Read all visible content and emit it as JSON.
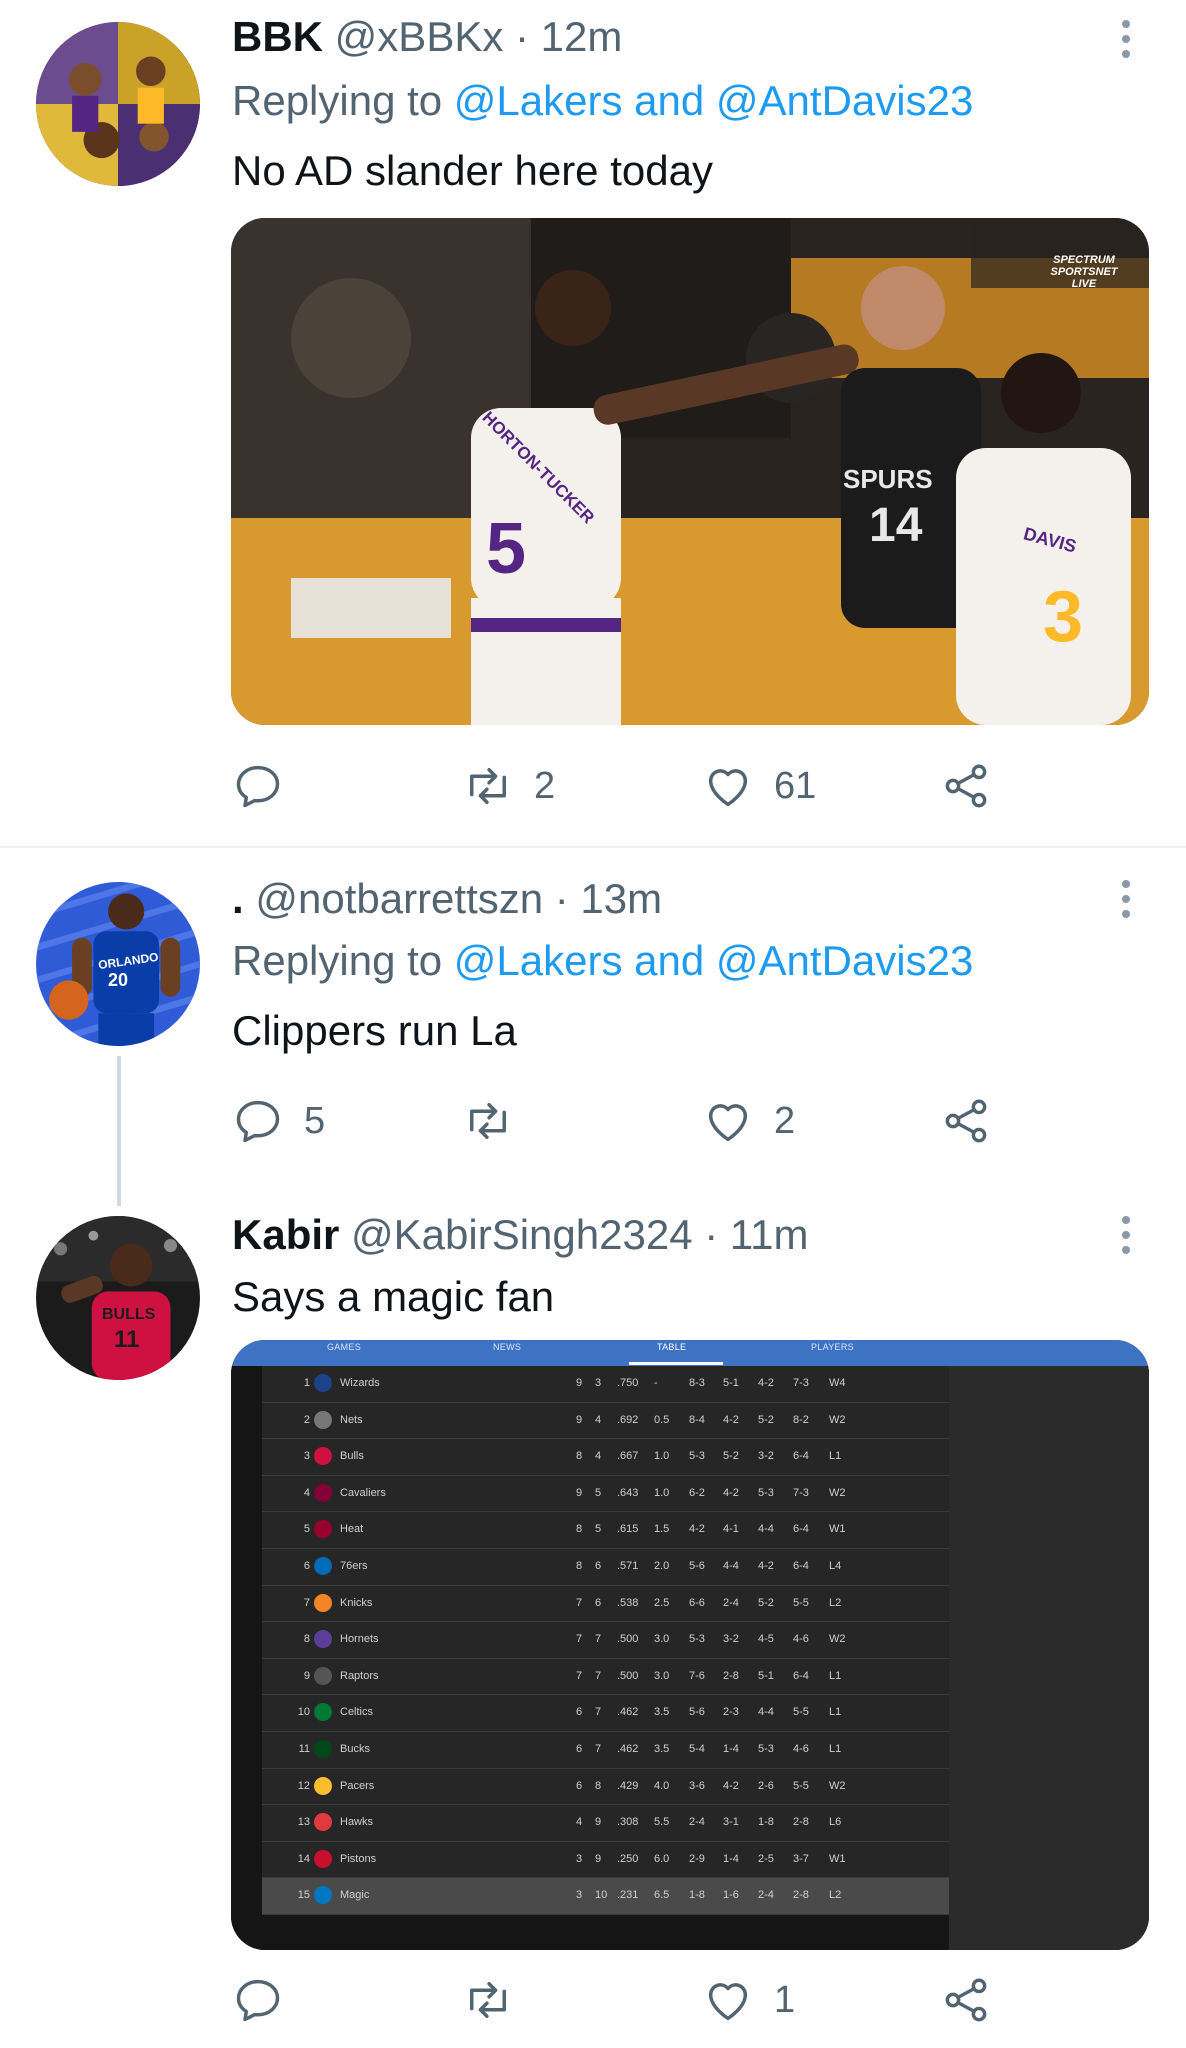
{
  "tweets": [
    {
      "name": "BBK",
      "handle": "@xBBKx",
      "time": "· 12m",
      "reply_prefix": "Replying to ",
      "reply_targets": "@Lakers and @AntDavis23",
      "text": "No AD slander here today",
      "media": {
        "type": "photo",
        "watermark": "SPECTRUM SPORTSNET LIVE",
        "jersey_numbers": [
          "5",
          "14",
          "3"
        ],
        "jersey_names": [
          "HORTON-TUCKER",
          "SPURS",
          "DAVIS"
        ]
      },
      "actions": {
        "replies": "",
        "retweets": "2",
        "likes": "61"
      }
    },
    {
      "name": ".",
      "handle": "@notbarrettszn",
      "time": "· 13m",
      "reply_prefix": "Replying to ",
      "reply_targets": "@Lakers and @AntDavis23",
      "text": "Clippers run La",
      "avatar_jersey": {
        "team": "ORLANDO",
        "number": "20"
      },
      "actions": {
        "replies": "5",
        "retweets": "",
        "likes": "2"
      }
    },
    {
      "name": "Kabir",
      "handle": "@KabirSingh2324",
      "time": "· 11m",
      "text": "Says a magic fan",
      "avatar_jersey": {
        "team": "BULLS",
        "number": "11"
      },
      "actions": {
        "replies": "",
        "retweets": "",
        "likes": "1"
      }
    }
  ],
  "standings": {
    "tabs": [
      "GAMES",
      "NEWS",
      "TABLE",
      "PLAYERS"
    ],
    "active_tab": "TABLE",
    "rows": [
      {
        "rank": "1",
        "team": "Wizards",
        "w": "9",
        "l": "3",
        "pct": ".750",
        "gb": "-",
        "home": "8-3",
        "away": "5-1",
        "conf": "4-2",
        "l10": "7-3",
        "strk": "W4",
        "color": "#1d428a"
      },
      {
        "rank": "2",
        "team": "Nets",
        "w": "9",
        "l": "4",
        "pct": ".692",
        "gb": "0.5",
        "home": "8-4",
        "away": "4-2",
        "conf": "5-2",
        "l10": "8-2",
        "strk": "W2",
        "color": "#777777"
      },
      {
        "rank": "3",
        "team": "Bulls",
        "w": "8",
        "l": "4",
        "pct": ".667",
        "gb": "1.0",
        "home": "5-3",
        "away": "5-2",
        "conf": "3-2",
        "l10": "6-4",
        "strk": "L1",
        "color": "#ce1141"
      },
      {
        "rank": "4",
        "team": "Cavaliers",
        "w": "9",
        "l": "5",
        "pct": ".643",
        "gb": "1.0",
        "home": "6-2",
        "away": "4-2",
        "conf": "5-3",
        "l10": "7-3",
        "strk": "W2",
        "color": "#860038"
      },
      {
        "rank": "5",
        "team": "Heat",
        "w": "8",
        "l": "5",
        "pct": ".615",
        "gb": "1.5",
        "home": "4-2",
        "away": "4-1",
        "conf": "4-4",
        "l10": "6-4",
        "strk": "W1",
        "color": "#98002e"
      },
      {
        "rank": "6",
        "team": "76ers",
        "w": "8",
        "l": "6",
        "pct": ".571",
        "gb": "2.0",
        "home": "5-6",
        "away": "4-4",
        "conf": "4-2",
        "l10": "6-4",
        "strk": "L4",
        "color": "#006bb6"
      },
      {
        "rank": "7",
        "team": "Knicks",
        "w": "7",
        "l": "6",
        "pct": ".538",
        "gb": "2.5",
        "home": "6-6",
        "away": "2-4",
        "conf": "5-2",
        "l10": "5-5",
        "strk": "L2",
        "color": "#f58426"
      },
      {
        "rank": "8",
        "team": "Hornets",
        "w": "7",
        "l": "7",
        "pct": ".500",
        "gb": "3.0",
        "home": "5-3",
        "away": "3-2",
        "conf": "4-5",
        "l10": "4-6",
        "strk": "W2",
        "color": "#5a3e9a"
      },
      {
        "rank": "9",
        "team": "Raptors",
        "w": "7",
        "l": "7",
        "pct": ".500",
        "gb": "3.0",
        "home": "7-6",
        "away": "2-8",
        "conf": "5-1",
        "l10": "6-4",
        "strk": "L1",
        "color": "#555555"
      },
      {
        "rank": "10",
        "team": "Celtics",
        "w": "6",
        "l": "7",
        "pct": ".462",
        "gb": "3.5",
        "home": "5-6",
        "away": "2-3",
        "conf": "4-4",
        "l10": "5-5",
        "strk": "L1",
        "color": "#007a33"
      },
      {
        "rank": "11",
        "team": "Bucks",
        "w": "6",
        "l": "7",
        "pct": ".462",
        "gb": "3.5",
        "home": "5-4",
        "away": "1-4",
        "conf": "5-3",
        "l10": "4-6",
        "strk": "L1",
        "color": "#00471b"
      },
      {
        "rank": "12",
        "team": "Pacers",
        "w": "6",
        "l": "8",
        "pct": ".429",
        "gb": "4.0",
        "home": "3-6",
        "away": "4-2",
        "conf": "2-6",
        "l10": "5-5",
        "strk": "W2",
        "color": "#fdbb30"
      },
      {
        "rank": "13",
        "team": "Hawks",
        "w": "4",
        "l": "9",
        "pct": ".308",
        "gb": "5.5",
        "home": "2-4",
        "away": "3-1",
        "conf": "1-8",
        "l10": "2-8",
        "strk": "L6",
        "color": "#e03a3e"
      },
      {
        "rank": "14",
        "team": "Pistons",
        "w": "3",
        "l": "9",
        "pct": ".250",
        "gb": "6.0",
        "home": "2-9",
        "away": "1-4",
        "conf": "2-5",
        "l10": "3-7",
        "strk": "W1",
        "color": "#c8102e"
      },
      {
        "rank": "15",
        "team": "Magic",
        "w": "3",
        "l": "10",
        "pct": ".231",
        "gb": "6.5",
        "home": "1-8",
        "away": "1-6",
        "conf": "2-4",
        "l10": "2-8",
        "strk": "L2",
        "color": "#0077c0"
      }
    ]
  },
  "icons": {
    "reply": "reply-icon",
    "retweet": "retweet-icon",
    "like": "heart-icon",
    "share": "share-icon",
    "more": "more-icon"
  },
  "colors": {
    "link": "#1d9bf0",
    "muted": "#536471",
    "table_tab_bar": "#3e72c2"
  }
}
